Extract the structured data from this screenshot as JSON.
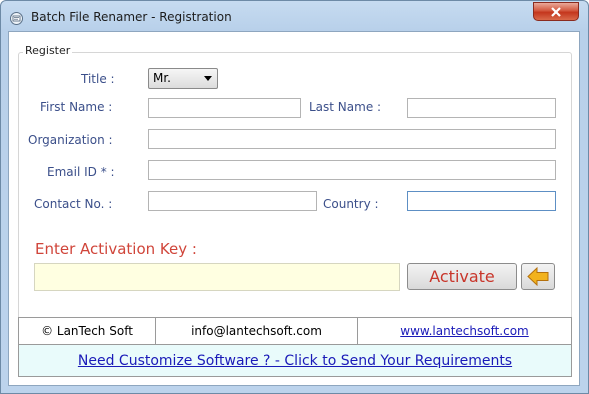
{
  "window": {
    "title": "Batch File Renamer - Registration"
  },
  "register": {
    "legend": "Register",
    "title_label": "Title :",
    "title_value": "Mr.",
    "first_name_label": "First Name :",
    "first_name_value": "",
    "last_name_label": "Last Name :",
    "last_name_value": "",
    "organization_label": "Organization :",
    "organization_value": "",
    "email_label": "Email ID * :",
    "email_value": "",
    "contact_label": "Contact No. :",
    "contact_value": "",
    "country_label": "Country :",
    "country_value": ""
  },
  "activation": {
    "label": "Enter Activation Key  :",
    "key_value": "",
    "activate_label": "Activate"
  },
  "footer": {
    "company": "© LanTech Soft",
    "email": "info@lantechsoft.com",
    "website": "www.lantechsoft.com",
    "customize_link": "Need Customize Software ? - Click to Send Your Requirements"
  },
  "colors": {
    "label_blue": "#3b4f8a",
    "activation_red": "#d0453a",
    "link_blue": "#1a1ab8",
    "key_field_bg": "#ffffe1",
    "footer_bottom_bg": "#e9fbfb"
  },
  "icons": {
    "app": "app-icon",
    "close": "close-icon",
    "back": "back-arrow-icon",
    "dropdown": "chevron-down-icon"
  }
}
